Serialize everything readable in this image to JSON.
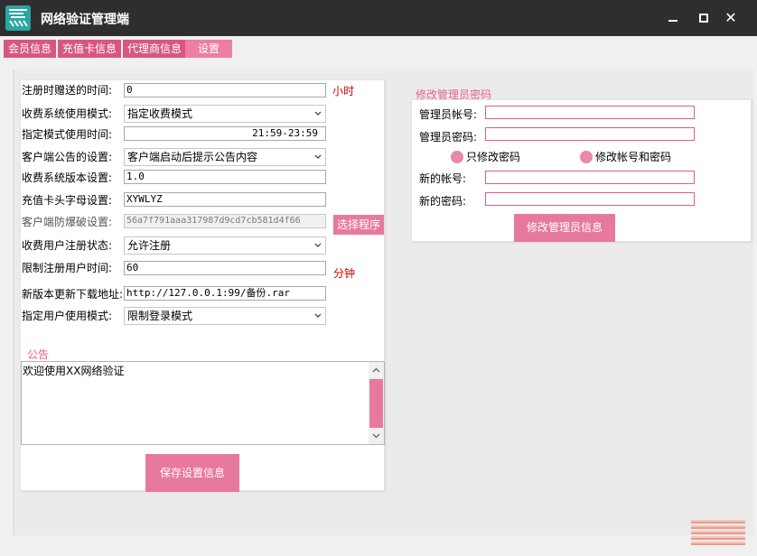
{
  "window": {
    "title": "网络验证管理端",
    "icon": "app-logo-icon"
  },
  "tabs": [
    {
      "label": "会员信息",
      "active": false
    },
    {
      "label": "充值卡信息",
      "active": false
    },
    {
      "label": "代理商信息",
      "active": false
    },
    {
      "label": "设置",
      "active": true
    }
  ],
  "settings": {
    "register_gift_time": {
      "label": "注册时赠送的时间:",
      "value": "0",
      "unit": "小时"
    },
    "charge_mode": {
      "label": "收费系统使用模式:",
      "value": "指定收费模式"
    },
    "mode_time": {
      "label": "指定模式使用时间:",
      "value": "21:59-23:59"
    },
    "client_notice": {
      "label": "客户端公告的设置:",
      "value": "客户端启动后提示公告内容"
    },
    "charge_version": {
      "label": "收费系统版本设置:",
      "value": "1.0"
    },
    "card_prefix": {
      "label": "充值卡头字母设置:",
      "value": "XYWLYZ"
    },
    "anti_crack": {
      "label": "客户端防爆破设置:",
      "value": "56a7f791aaa317987d9cd7cb581d4f66",
      "button": "选择程序"
    },
    "register_status": {
      "label": "收费用户注册状态:",
      "value": "允许注册"
    },
    "limit_time": {
      "label": "限制注册用户时间:",
      "value": "60",
      "unit": "分钟"
    },
    "update_url": {
      "label": "新版本更新下载地址:",
      "value": "http://127.0.0.1:99/备份.rar"
    },
    "user_mode": {
      "label": "指定用户使用模式:",
      "value": "限制登录模式"
    }
  },
  "notice": {
    "title": "公告",
    "content": "欢迎使用XX网络验证"
  },
  "save_button": "保存设置信息",
  "admin": {
    "title": "修改管理员密码",
    "account_label": "管理员帐号:",
    "account_value": "",
    "password_label": "管理员密码:",
    "password_value": "",
    "radio_password_only": "只修改密码",
    "radio_both": "修改帐号和密码",
    "new_account_label": "新的帐号:",
    "new_account_value": "",
    "new_password_label": "新的密码:",
    "new_password_value": "",
    "submit_button": "修改管理员信息"
  },
  "colors": {
    "accent": "#e8799e",
    "tab": "#d8577e",
    "title_bar": "#2e2e2e",
    "unit_text": "#d40000"
  }
}
